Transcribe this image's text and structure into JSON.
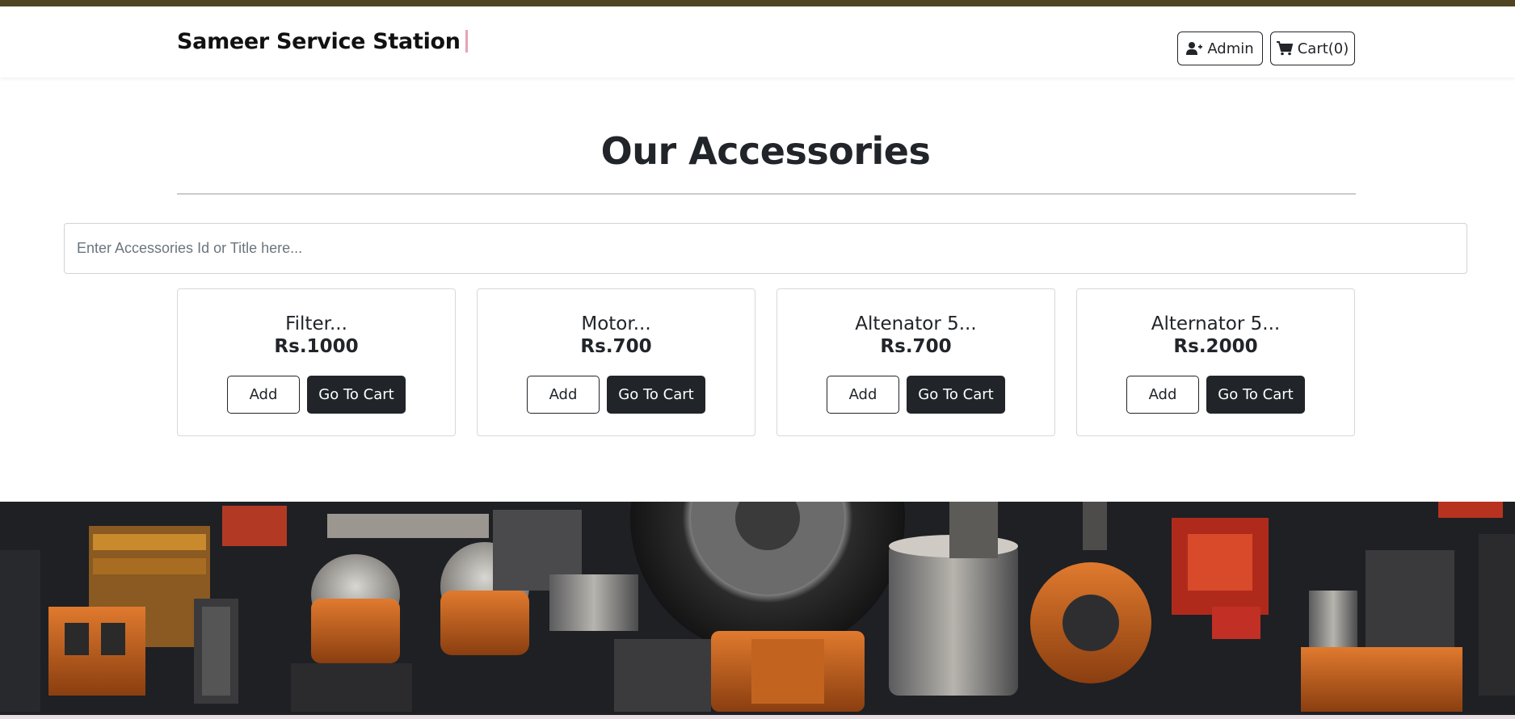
{
  "header": {
    "brand": "Sameer Service Station",
    "admin_label": "Admin",
    "admin_icon": "user-plus-icon",
    "cart_label": "Cart(0)",
    "cart_icon": "shopping-cart-icon"
  },
  "main": {
    "title": "Our Accessories",
    "search_placeholder": "Enter Accessories Id or Title here...",
    "search_value": ""
  },
  "products": [
    {
      "title": "Filter...",
      "price": "Rs.1000",
      "add_label": "Add",
      "cart_label": "Go To Cart"
    },
    {
      "title": "Motor...",
      "price": "Rs.700",
      "add_label": "Add",
      "cart_label": "Go To Cart"
    },
    {
      "title": "Altenator 5...",
      "price": "Rs.700",
      "add_label": "Add",
      "cart_label": "Go To Cart"
    },
    {
      "title": "Alternator 5...",
      "price": "Rs.2000",
      "add_label": "Add",
      "cart_label": "Go To Cart"
    }
  ],
  "colors": {
    "top_strip": "#4f4424",
    "dark_button": "#212529",
    "text": "#212529",
    "accent_cursor": "#e9a3b4"
  }
}
